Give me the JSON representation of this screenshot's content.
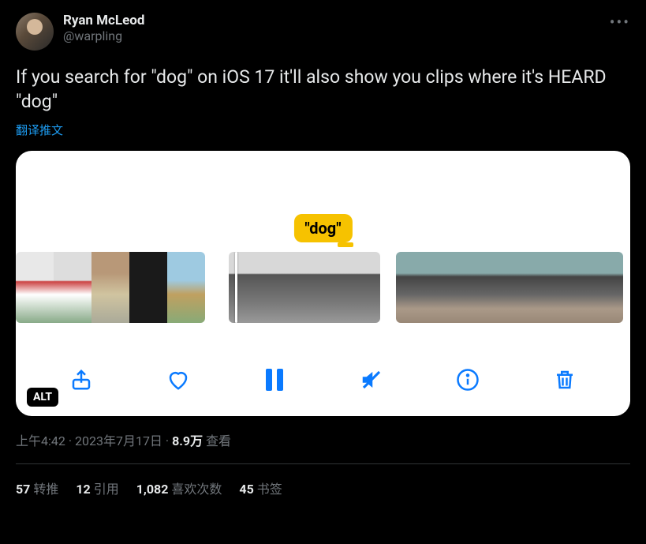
{
  "author": {
    "display_name": "Ryan McLeod",
    "handle": "@warpling"
  },
  "tweet_text": "If you search for \"dog\" on iOS 17 it'll also show you clips where it's HEARD \"dog\"",
  "translate_label": "翻译推文",
  "media": {
    "badge_text": "\"dog\"",
    "alt_label": "ALT"
  },
  "meta": {
    "time": "上午4:42",
    "date": "2023年7月17日",
    "views_count": "8.9万",
    "views_label": "查看"
  },
  "stats": {
    "retweets": {
      "count": "57",
      "label": "转推"
    },
    "quotes": {
      "count": "12",
      "label": "引用"
    },
    "likes": {
      "count": "1,082",
      "label": "喜欢次数"
    },
    "bookmarks": {
      "count": "45",
      "label": "书签"
    }
  }
}
